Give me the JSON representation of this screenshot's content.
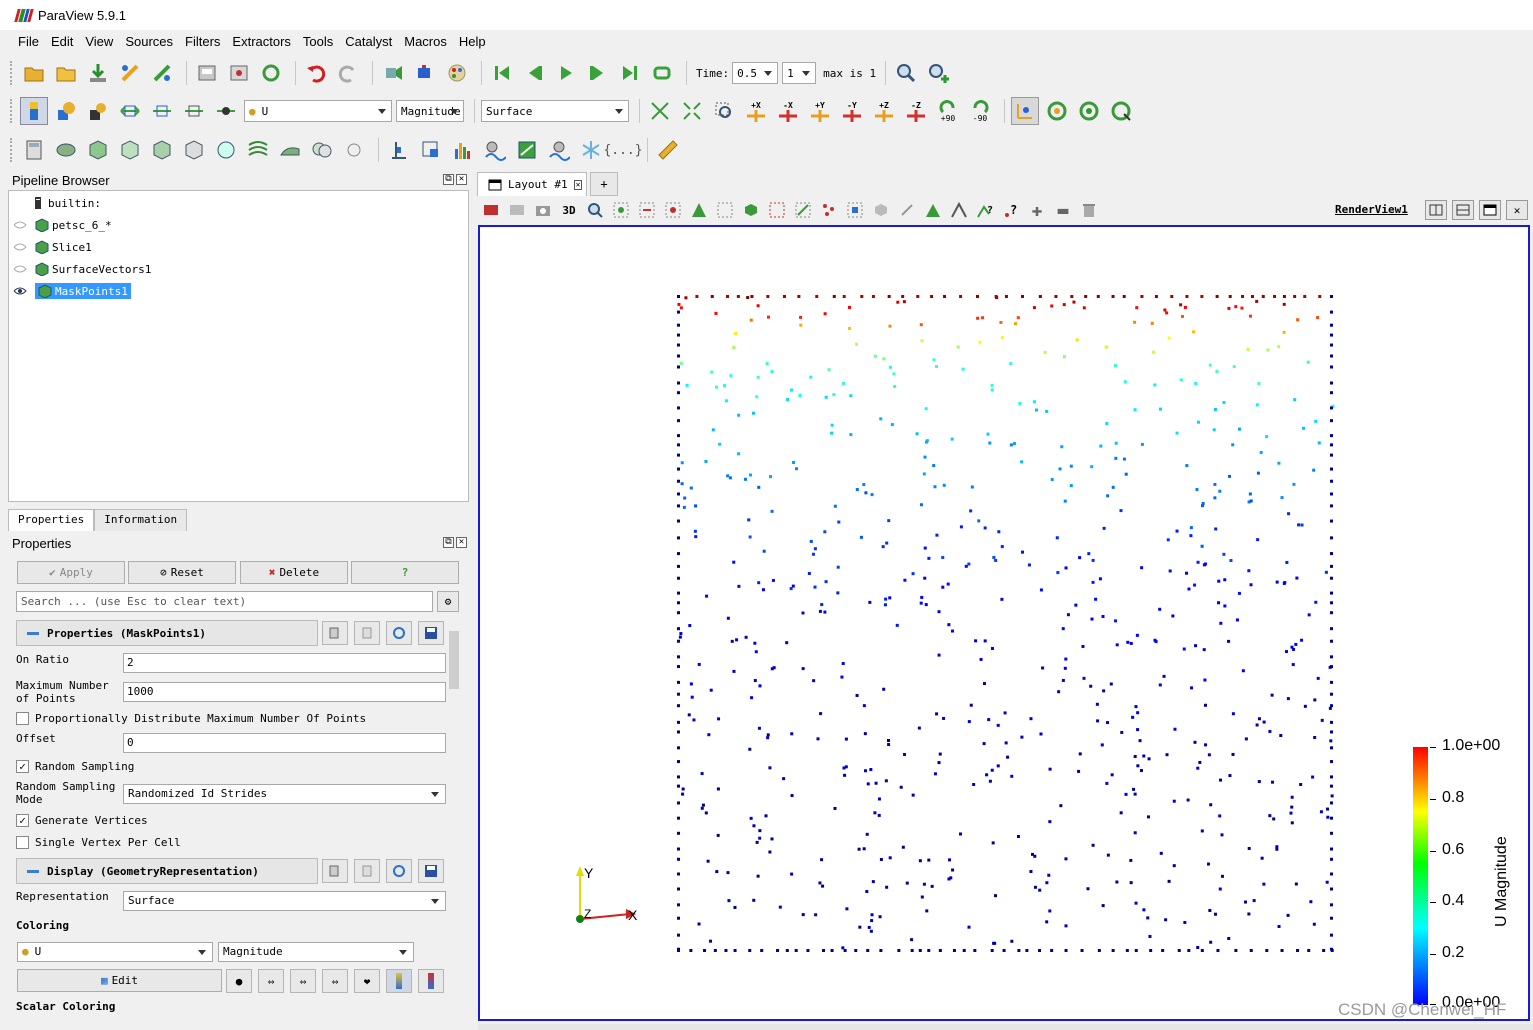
{
  "window": {
    "title": "ParaView 5.9.1"
  },
  "menubar": [
    "File",
    "Edit",
    "View",
    "Sources",
    "Filters",
    "Extractors",
    "Tools",
    "Catalyst",
    "Macros",
    "Help"
  ],
  "toolbar": {
    "time_label": "Time:",
    "time_value": "0.5",
    "timestep_value": "1",
    "max_label": "max is 1",
    "color_array": "U",
    "color_component": "Magnitude",
    "representation": "Surface",
    "camera_x_pos": "+X",
    "camera_x_neg": "-X",
    "camera_y_pos": "+Y",
    "camera_y_neg": "-Y",
    "camera_z_pos": "+Z",
    "camera_z_neg": "-Z",
    "rotate_pos": "+90",
    "rotate_neg": "-90",
    "braces_icon_label": "{...}"
  },
  "pipeline": {
    "title": "Pipeline Browser",
    "items": [
      {
        "label": "builtin:"
      },
      {
        "label": "petsc_6_*"
      },
      {
        "label": "Slice1"
      },
      {
        "label": "SurfaceVectors1"
      },
      {
        "label": "MaskPoints1"
      }
    ]
  },
  "tabs": [
    "Properties",
    "Information"
  ],
  "properties": {
    "title": "Properties",
    "apply_label": "Apply",
    "reset_label": "Reset",
    "delete_label": "Delete",
    "help_label": "?",
    "search_placeholder": "Search ... (use Esc to clear text)",
    "section_props": "Properties (MaskPoints1)",
    "on_ratio_label": "On Ratio",
    "on_ratio_value": "2",
    "max_points_label": "Maximum Number of Points",
    "max_points_value": "1000",
    "prop_dist_label": "Proportionally Distribute Maximum Number Of Points",
    "offset_label": "Offset",
    "offset_value": "0",
    "random_sampling_label": "Random Sampling",
    "random_mode_label": "Random Sampling Mode",
    "random_mode_value": "Randomized Id Strides",
    "gen_vertices_label": "Generate Vertices",
    "single_vertex_label": "Single Vertex Per Cell",
    "section_display": "Display (GeometryRepresentation)",
    "representation_label": "Representation",
    "representation_value": "Surface",
    "coloring_label": "Coloring",
    "coloring_array": "U",
    "coloring_component": "Magnitude",
    "edit_label": "Edit",
    "scalar_coloring_label": "Scalar Coloring"
  },
  "layout": {
    "tab_label": "Layout #1",
    "plus_label": "+",
    "view_3d": "3D",
    "render_view": "RenderView1"
  },
  "colorbar": {
    "title": "U Magnitude",
    "ticks": [
      "1.0e+00",
      "0.8",
      "0.6",
      "0.4",
      "0.2",
      "0.0e+00"
    ],
    "range": [
      0,
      1
    ]
  },
  "axes": {
    "x": "X",
    "y": "Y",
    "z": "Z"
  },
  "watermark": "CSDN @Chenwei_HF"
}
